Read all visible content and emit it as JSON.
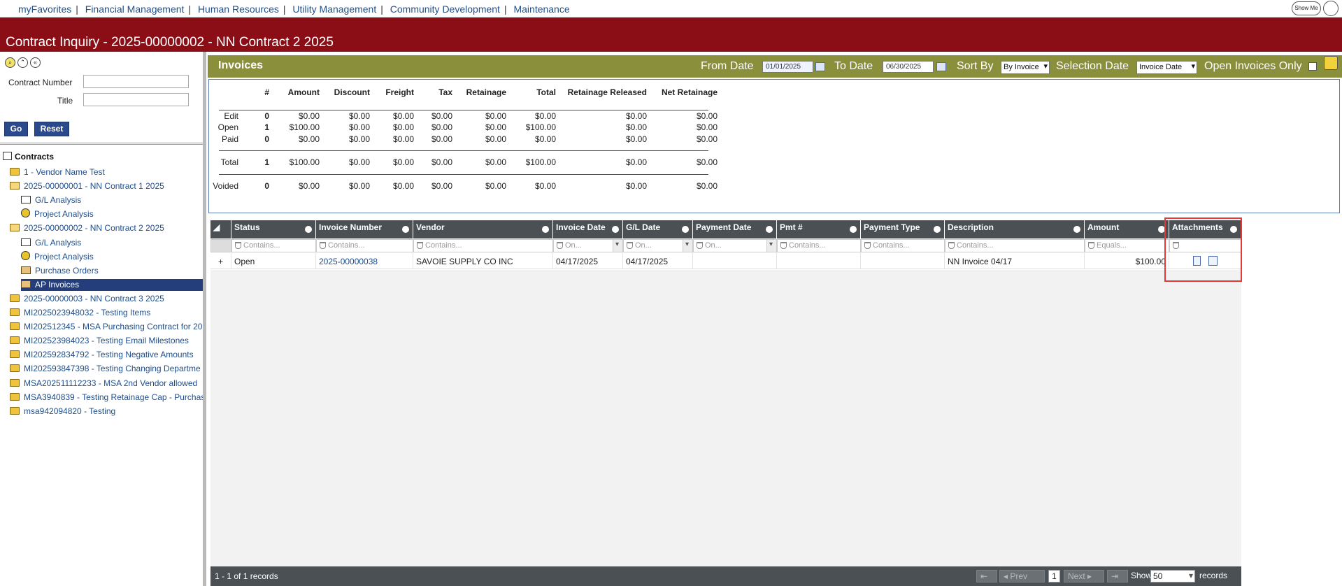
{
  "topnav": {
    "links": [
      "myFavorites",
      "Financial Management",
      "Human Resources",
      "Utility Management",
      "Community Development",
      "Maintenance"
    ],
    "show_me": "Show Me"
  },
  "title": "Contract Inquiry - 2025-00000002 - NN Contract 2 2025",
  "left": {
    "contract_number_label": "Contract Number",
    "title_label": "Title",
    "contract_number_value": "",
    "title_value": "",
    "go": "Go",
    "reset": "Reset",
    "tree_root": "Contracts",
    "tree": [
      {
        "label": "1 - Vendor Name Test",
        "icon": "folder-icon"
      },
      {
        "label": "2025-00000001 - NN Contract 1 2025",
        "icon": "folder-open-icon"
      },
      {
        "label": "G/L Analysis",
        "icon": "gl-analysis-icon"
      },
      {
        "label": "Project Analysis",
        "icon": "project-analysis-icon"
      },
      {
        "label": "2025-00000002 - NN Contract 2 2025",
        "icon": "folder-open-icon"
      },
      {
        "label": "G/L Analysis",
        "icon": "gl-analysis-icon"
      },
      {
        "label": "Project Analysis",
        "icon": "project-analysis-icon"
      },
      {
        "label": "Purchase Orders",
        "icon": "purchase-orders-icon"
      },
      {
        "label": "AP Invoices",
        "icon": "ap-invoices-icon"
      },
      {
        "label": "2025-00000003 - NN Contract 3 2025",
        "icon": "folder-icon"
      },
      {
        "label": "MI2025023948032 - Testing Items",
        "icon": "folder-icon"
      },
      {
        "label": "MI202512345 - MSA Purchasing Contract for 20",
        "icon": "folder-icon"
      },
      {
        "label": "MI202523984023 - Testing Email Milestones",
        "icon": "folder-icon"
      },
      {
        "label": "MI202592834792 - Testing Negative Amounts",
        "icon": "folder-icon"
      },
      {
        "label": "MI202593847398 - Testing Changing Departme",
        "icon": "folder-icon"
      },
      {
        "label": "MSA202511112233 - MSA 2nd Vendor allowed",
        "icon": "folder-icon"
      },
      {
        "label": "MSA3940839 - Testing Retainage Cap - Purchas",
        "icon": "folder-icon"
      },
      {
        "label": "msa942094820 - Testing",
        "icon": "folder-icon"
      }
    ]
  },
  "invoices_bar": {
    "title": "Invoices",
    "from_date_label": "From Date",
    "from_date": "01/01/2025",
    "to_date_label": "To Date",
    "to_date": "06/30/2025",
    "sort_by_label": "Sort By",
    "sort_by": "By Invoice",
    "selection_date_label": "Selection Date",
    "selection_date": "Invoice Date",
    "open_only_label": "Open Invoices Only"
  },
  "summary": {
    "headers": [
      "#",
      "Amount",
      "Discount",
      "Freight",
      "Tax",
      "Retainage",
      "Total",
      "Retainage Released",
      "Net Retainage"
    ],
    "rows": [
      {
        "label": "Edit",
        "values": [
          "0",
          "$0.00",
          "$0.00",
          "$0.00",
          "$0.00",
          "$0.00",
          "$0.00",
          "$0.00",
          "$0.00"
        ]
      },
      {
        "label": "Open",
        "values": [
          "1",
          "$100.00",
          "$0.00",
          "$0.00",
          "$0.00",
          "$0.00",
          "$100.00",
          "$0.00",
          "$0.00"
        ]
      },
      {
        "label": "Paid",
        "values": [
          "0",
          "$0.00",
          "$0.00",
          "$0.00",
          "$0.00",
          "$0.00",
          "$0.00",
          "$0.00",
          "$0.00"
        ]
      },
      {
        "label": "Total",
        "values": [
          "1",
          "$100.00",
          "$0.00",
          "$0.00",
          "$0.00",
          "$0.00",
          "$100.00",
          "$0.00",
          "$0.00"
        ]
      },
      {
        "label": "Voided",
        "values": [
          "0",
          "$0.00",
          "$0.00",
          "$0.00",
          "$0.00",
          "$0.00",
          "$0.00",
          "$0.00",
          "$0.00"
        ]
      }
    ]
  },
  "grid": {
    "columns": [
      "Status",
      "Invoice Number",
      "Vendor",
      "Invoice Date",
      "G/L Date",
      "Payment Date",
      "Pmt #",
      "Payment Type",
      "Description",
      "Amount",
      "Attachments"
    ],
    "filters": [
      "Contains...",
      "Contains...",
      "Contains...",
      "On...",
      "On...",
      "On...",
      "Contains...",
      "Contains...",
      "Contains...",
      "Equals...",
      ""
    ],
    "rows": [
      {
        "expand": "+",
        "status": "Open",
        "invoice_number": "2025-00000038",
        "vendor": "SAVOIE SUPPLY CO INC",
        "invoice_date": "04/17/2025",
        "gl_date": "04/17/2025",
        "payment_date": "",
        "pmt_no": "",
        "payment_type": "",
        "description": "NN Invoice 04/17",
        "amount": "$100.00"
      }
    ],
    "record_count": "1 - 1 of 1 records",
    "prev": "Prev",
    "next": "Next",
    "page": "1",
    "show_label": "Show",
    "show_value": "50",
    "records_label": "records"
  }
}
